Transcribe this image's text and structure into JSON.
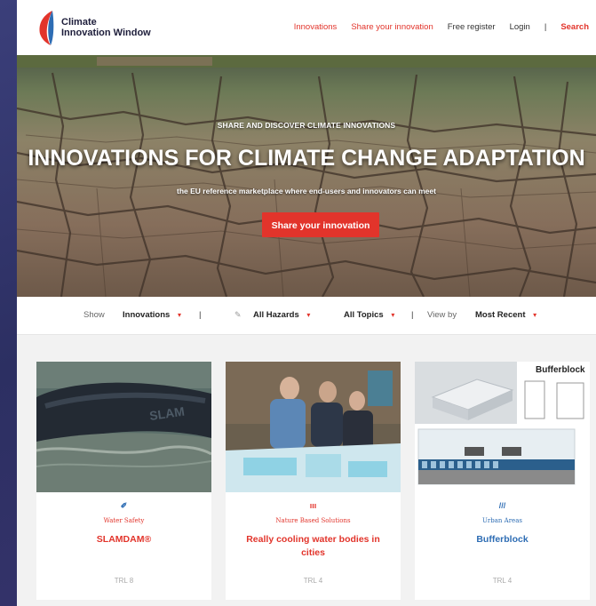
{
  "brand": {
    "line1": "Climate",
    "line2": "Innovation Window"
  },
  "nav": {
    "innovations": "Innovations",
    "share": "Share your innovation",
    "register": "Free register",
    "login": "Login",
    "separator": "|",
    "search": "Search"
  },
  "hero": {
    "kicker": "SHARE AND DISCOVER CLIMATE INNOVATIONS",
    "title": "INNOVATIONS FOR CLIMATE CHANGE ADAPTATION",
    "subtitle": "the EU reference marketplace where end-users and innovators can meet",
    "button": "Share your innovation"
  },
  "filters": {
    "show_label": "Show",
    "type_value": "Innovations",
    "sep": "|",
    "hazards_value": "All Hazards",
    "topics_value": "All Topics",
    "viewby_label": "View by",
    "sort_value": "Most Recent"
  },
  "cards": [
    {
      "icon": "✐",
      "category": "Water Safety",
      "title": "SLAMDAM®",
      "trl": "TRL 8"
    },
    {
      "icon": "ııı",
      "category": "Nature Based Solutions",
      "title": "Really cooling water bodies in cities",
      "trl": "TRL 4"
    },
    {
      "icon": "///",
      "category": "Urban Areas",
      "title": "Bufferblock",
      "trl": "TRL 4",
      "image_label": "Bufferblock"
    }
  ],
  "colors": {
    "accent": "#e2342b",
    "link_blue": "#2e6db4",
    "brand_dark": "#1d1d3a"
  }
}
